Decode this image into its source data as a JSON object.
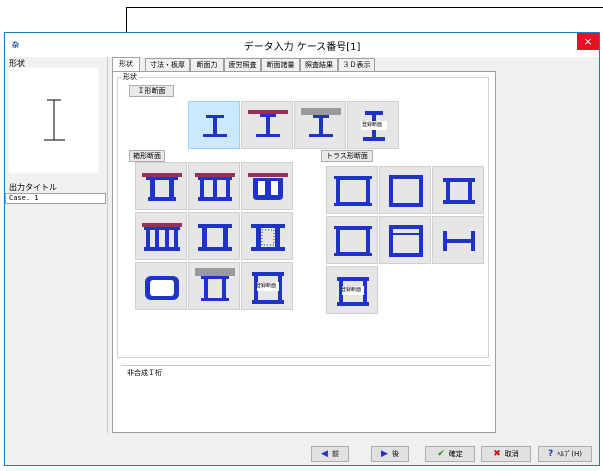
{
  "window": {
    "title": "データ入力 ケース番号[1]",
    "close": "×",
    "app_icon": "杂"
  },
  "left": {
    "shape_label": "形状",
    "output_label": "出力タイトル",
    "output_value": "Case. 1"
  },
  "tabs": [
    "形状",
    "寸法・板厚",
    "断面力",
    "疲労照査",
    "断面諸量",
    "照査結果",
    "３Ｄ表示"
  ],
  "content": {
    "group_label": "形状",
    "i_section": "Ｉ形断面",
    "box_section": "箱形断面",
    "truss_section": "トラス形断面",
    "registered": "登録断面",
    "status_text": "非合成Ｉ桁"
  },
  "buttons": {
    "prev": "前",
    "next": "後",
    "ok": "確定",
    "cancel": "取消",
    "help": "ﾍﾙﾌﾟ(H)"
  },
  "colors": {
    "accent": "#1e79c9",
    "steel": "#1f33c8",
    "deck": "#9b2f5c",
    "concrete": "#9a9a9a",
    "close": "#e81123",
    "selected": "#cce8ff"
  }
}
